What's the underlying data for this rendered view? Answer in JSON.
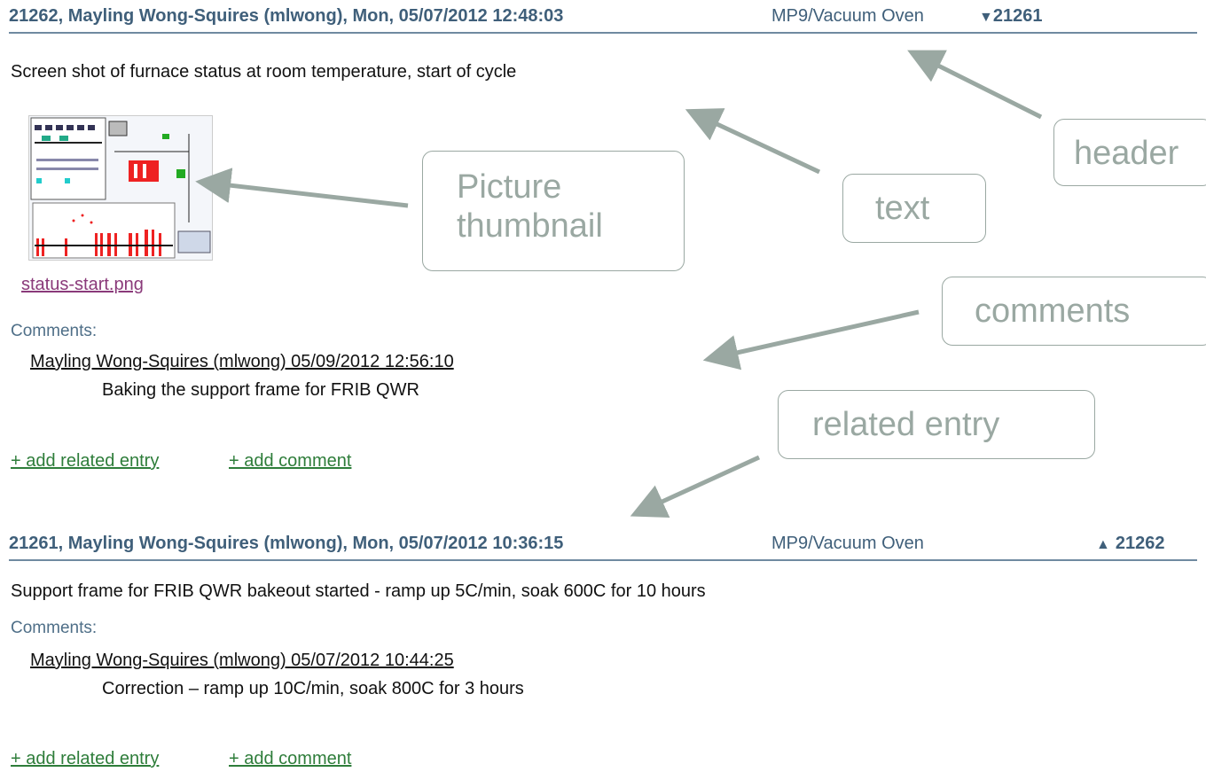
{
  "entries": [
    {
      "header": {
        "meta": "21262, Mayling Wong-Squires (mlwong), Mon, 05/07/2012 12:48:03",
        "category": "MP9/Vacuum Oven",
        "related_arrow": "▼",
        "related": "21261"
      },
      "text": "Screen shot of furnace status at room temperature, start of cycle",
      "attachment": {
        "filename": "status-start.png"
      },
      "comments_label": "Comments:",
      "comments": [
        {
          "author": "Mayling Wong-Squires (mlwong) 05/09/2012 12:56:10",
          "body": "Baking the support frame for FRIB QWR"
        }
      ],
      "actions": {
        "add_related": "+ add related entry",
        "add_comment": "+ add comment"
      }
    },
    {
      "header": {
        "meta": "21261, Mayling Wong-Squires (mlwong), Mon, 05/07/2012 10:36:15",
        "category": "MP9/Vacuum Oven",
        "related_arrow": "▲",
        "related": "21262"
      },
      "text": "Support frame for FRIB QWR bakeout started - ramp up 5C/min, soak 600C for 10 hours",
      "comments_label": "Comments:",
      "comments": [
        {
          "author": "Mayling Wong-Squires (mlwong) 05/07/2012 10:44:25",
          "body": "Correction – ramp up 10C/min, soak 800C for 3 hours"
        }
      ],
      "actions": {
        "add_related": "+ add related entry",
        "add_comment": "+ add comment"
      }
    }
  ],
  "callouts": {
    "header": "header",
    "text": "text",
    "picture_line1": "Picture",
    "picture_line2": "thumbnail",
    "comments": "comments",
    "related": "related entry"
  },
  "colors": {
    "header_text": "#3f5f7a",
    "rule": "#6f8aa0",
    "action_link": "#2e7d3a",
    "file_link": "#8a3a7a",
    "callout": "#9aa8a2"
  }
}
